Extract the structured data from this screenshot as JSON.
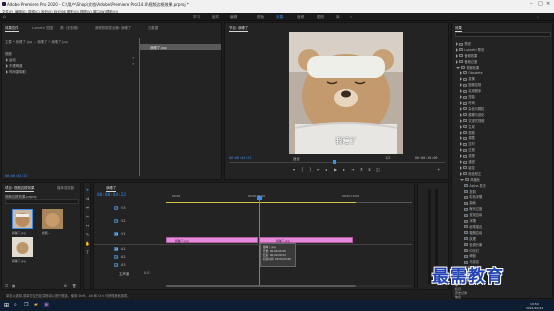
{
  "window": {
    "title": "Adobe Premiere Pro 2020 - C:\\用户\\Shop\\文档\\Adobe\\Premiere Pro\\14.0\\视频边框效果.prproj *"
  },
  "menu": [
    "文件(F)",
    "编辑(E)",
    "剪辑(C)",
    "序列(S)",
    "标记(M)",
    "图形(G)",
    "视图(V)",
    "窗口(W)",
    "帮助(H)"
  ],
  "workspaces": {
    "items": [
      "学习",
      "组件",
      "编辑",
      "颜色",
      "效果",
      "音频",
      "图形",
      "库"
    ],
    "active_index": 4
  },
  "effect_controls": {
    "tabs": [
      "效果控件",
      "Lumetri 范围",
      "源: (无剪辑)",
      "音频剪辑混合器: 我睡了",
      "元数据"
    ],
    "clip_path": "主要 * 我睡了.jpg  ⌄  我睡了 * 我睡了.jpg",
    "clip_label": "我睡了.jpg",
    "section_label": "视频",
    "rows": [
      "运动",
      "不透明度",
      "时间重映射"
    ],
    "timecode": "00:00:04:22"
  },
  "program_monitor": {
    "tab": "节目: 我睡了",
    "subtitle": "我睡了",
    "timecode_left": "00:00:04:22",
    "fit": "适合",
    "ratio": "1/2",
    "timecode_right": "00:00:10:00"
  },
  "project": {
    "tabs": [
      "项目: 视频边框效果",
      "媒体浏览器"
    ],
    "file_label": "视频边框效果.prproj",
    "thumb_labels": [
      "我睡了.jpg",
      "视频...",
      "我睡了.jpg"
    ],
    "thumb_durations": [
      "5:00",
      "10:00",
      "5:00"
    ]
  },
  "timeline": {
    "tab": "我睡了",
    "timecode": "00:00:04:22",
    "ruler": [
      "00:00",
      "00:00:05:00",
      "00:00:10:00"
    ],
    "tracks": [
      "V3",
      "V2",
      "V1",
      "A1",
      "A2",
      "A3"
    ],
    "master": "主声道",
    "master_value": "0.0",
    "clip1": "我睡了.jpg",
    "clip2": "我睡了.jpg",
    "tooltip": [
      "我睡了.jpg",
      "开始: 00:00:05:00",
      "结束: 00:00:09:24",
      "持续时间: 00:00:05:00"
    ]
  },
  "effects": {
    "tab": "效果",
    "items": [
      {
        "label": "预设",
        "depth": 0,
        "open": false
      },
      {
        "label": "Lumetri 预设",
        "depth": 0,
        "open": false
      },
      {
        "label": "音频效果",
        "depth": 0,
        "open": false
      },
      {
        "label": "音频过渡",
        "depth": 0,
        "open": false
      },
      {
        "label": "视频效果",
        "depth": 0,
        "open": true
      },
      {
        "label": "Obsolete",
        "depth": 1,
        "open": false
      },
      {
        "label": "变换",
        "depth": 1,
        "open": false
      },
      {
        "label": "图像控制",
        "depth": 1,
        "open": false
      },
      {
        "label": "实用程序",
        "depth": 1,
        "open": false
      },
      {
        "label": "扭曲",
        "depth": 1,
        "open": false
      },
      {
        "label": "时间",
        "depth": 1,
        "open": false
      },
      {
        "label": "杂色与颗粒",
        "depth": 1,
        "open": false
      },
      {
        "label": "模糊与锐化",
        "depth": 1,
        "open": false
      },
      {
        "label": "沉浸式视频",
        "depth": 1,
        "open": false
      },
      {
        "label": "生成",
        "depth": 1,
        "open": false
      },
      {
        "label": "视频",
        "depth": 1,
        "open": false
      },
      {
        "label": "调整",
        "depth": 1,
        "open": false
      },
      {
        "label": "过时",
        "depth": 1,
        "open": false
      },
      {
        "label": "过渡",
        "depth": 1,
        "open": false
      },
      {
        "label": "透视",
        "depth": 1,
        "open": false
      },
      {
        "label": "通道",
        "depth": 1,
        "open": false
      },
      {
        "label": "键控",
        "depth": 1,
        "open": false
      },
      {
        "label": "颜色校正",
        "depth": 1,
        "open": false
      },
      {
        "label": "风格化",
        "depth": 1,
        "open": true
      },
      {
        "label": "Alpha 发光",
        "depth": 2,
        "open": false
      },
      {
        "label": "复制",
        "depth": 2,
        "open": false
      },
      {
        "label": "彩色浮雕",
        "depth": 2,
        "open": false
      },
      {
        "label": "抽帧",
        "depth": 2,
        "open": false
      },
      {
        "label": "曝光过度",
        "depth": 2,
        "open": false
      },
      {
        "label": "查找边缘",
        "depth": 2,
        "open": false
      },
      {
        "label": "浮雕",
        "depth": 2,
        "open": false
      },
      {
        "label": "画笔描边",
        "depth": 2,
        "open": false
      },
      {
        "label": "粗糙边缘",
        "depth": 2,
        "open": false
      },
      {
        "label": "纹理",
        "depth": 2,
        "open": false
      },
      {
        "label": "色调分离",
        "depth": 2,
        "open": false
      },
      {
        "label": "闪光灯",
        "depth": 2,
        "open": false
      },
      {
        "label": "阈值",
        "depth": 2,
        "open": false
      },
      {
        "label": "马赛克",
        "depth": 2,
        "open": false
      },
      {
        "label": "视频过渡",
        "depth": 0,
        "open": false
      }
    ],
    "bottom": [
      "基本图形",
      "基本声音",
      "Lumetri 颜色",
      "库",
      "标记",
      "历史记录",
      "信息"
    ]
  },
  "status_bar": "单击以选择,或单击空白处并拖动以进行框选。使用 Shift、Alt 和 Ctrl 可获得其他选项。",
  "watermark": "最需教育",
  "taskbar": {
    "time": "19:50",
    "date": "2021/10/12"
  },
  "colors": {
    "accent": "#3f8de8",
    "clip_pink": "#e48ad8",
    "panel": "#232323"
  }
}
